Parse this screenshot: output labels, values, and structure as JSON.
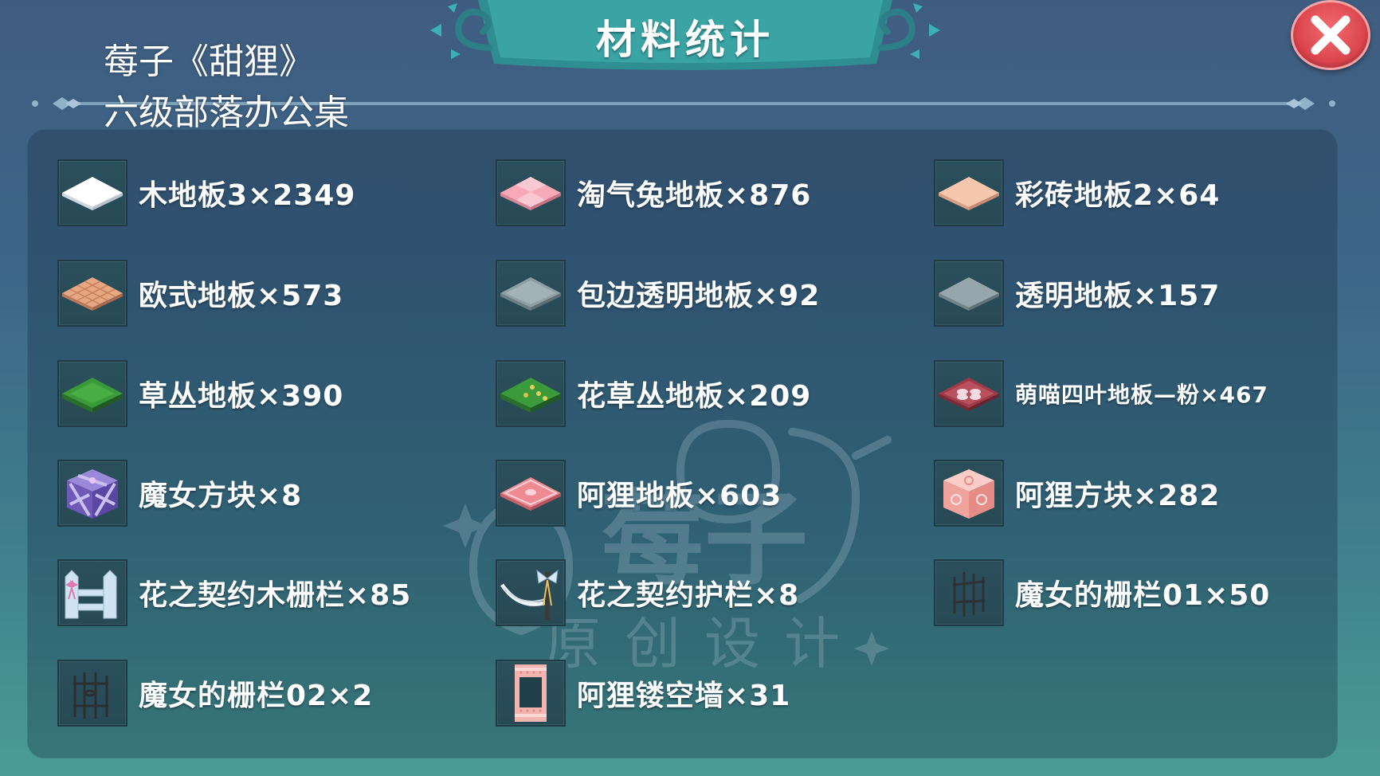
{
  "header": {
    "title": "材料统计"
  },
  "caption": {
    "line1": "莓子《甜狸》",
    "line2": "六级部落办公桌"
  },
  "watermark": {
    "main": "莓子",
    "sub": "原创设计"
  },
  "close_button": {
    "icon": "close-icon"
  },
  "materials": [
    {
      "label": "木地板3×2349",
      "icon": "white-floor-tile-icon"
    },
    {
      "label": "淘气兔地板×876",
      "icon": "pink-checker-floor-icon"
    },
    {
      "label": "彩砖地板2×64",
      "icon": "peach-tile-floor-icon"
    },
    {
      "label": "欧式地板×573",
      "icon": "european-floor-icon"
    },
    {
      "label": "包边透明地板×92",
      "icon": "edged-transparent-floor-icon"
    },
    {
      "label": "透明地板×157",
      "icon": "transparent-floor-icon"
    },
    {
      "label": "草丛地板×390",
      "icon": "grass-floor-icon"
    },
    {
      "label": "花草丛地板×209",
      "icon": "flower-grass-floor-icon"
    },
    {
      "label": "萌喵四叶地板—粉×467",
      "icon": "clover-floor-pink-icon"
    },
    {
      "label": "魔女方块×8",
      "icon": "witch-cube-icon"
    },
    {
      "label": "阿狸地板×603",
      "icon": "ali-floor-icon"
    },
    {
      "label": "阿狸方块×282",
      "icon": "ali-cube-icon"
    },
    {
      "label": "花之契约木栅栏×85",
      "icon": "flower-wood-fence-icon"
    },
    {
      "label": "花之契约护栏×8",
      "icon": "flower-guardrail-icon"
    },
    {
      "label": "魔女的栅栏01×50",
      "icon": "witch-fence-01-icon"
    },
    {
      "label": "魔女的栅栏02×2",
      "icon": "witch-fence-02-icon"
    },
    {
      "label": "阿狸镂空墙×31",
      "icon": "ali-hollow-wall-icon"
    }
  ]
}
